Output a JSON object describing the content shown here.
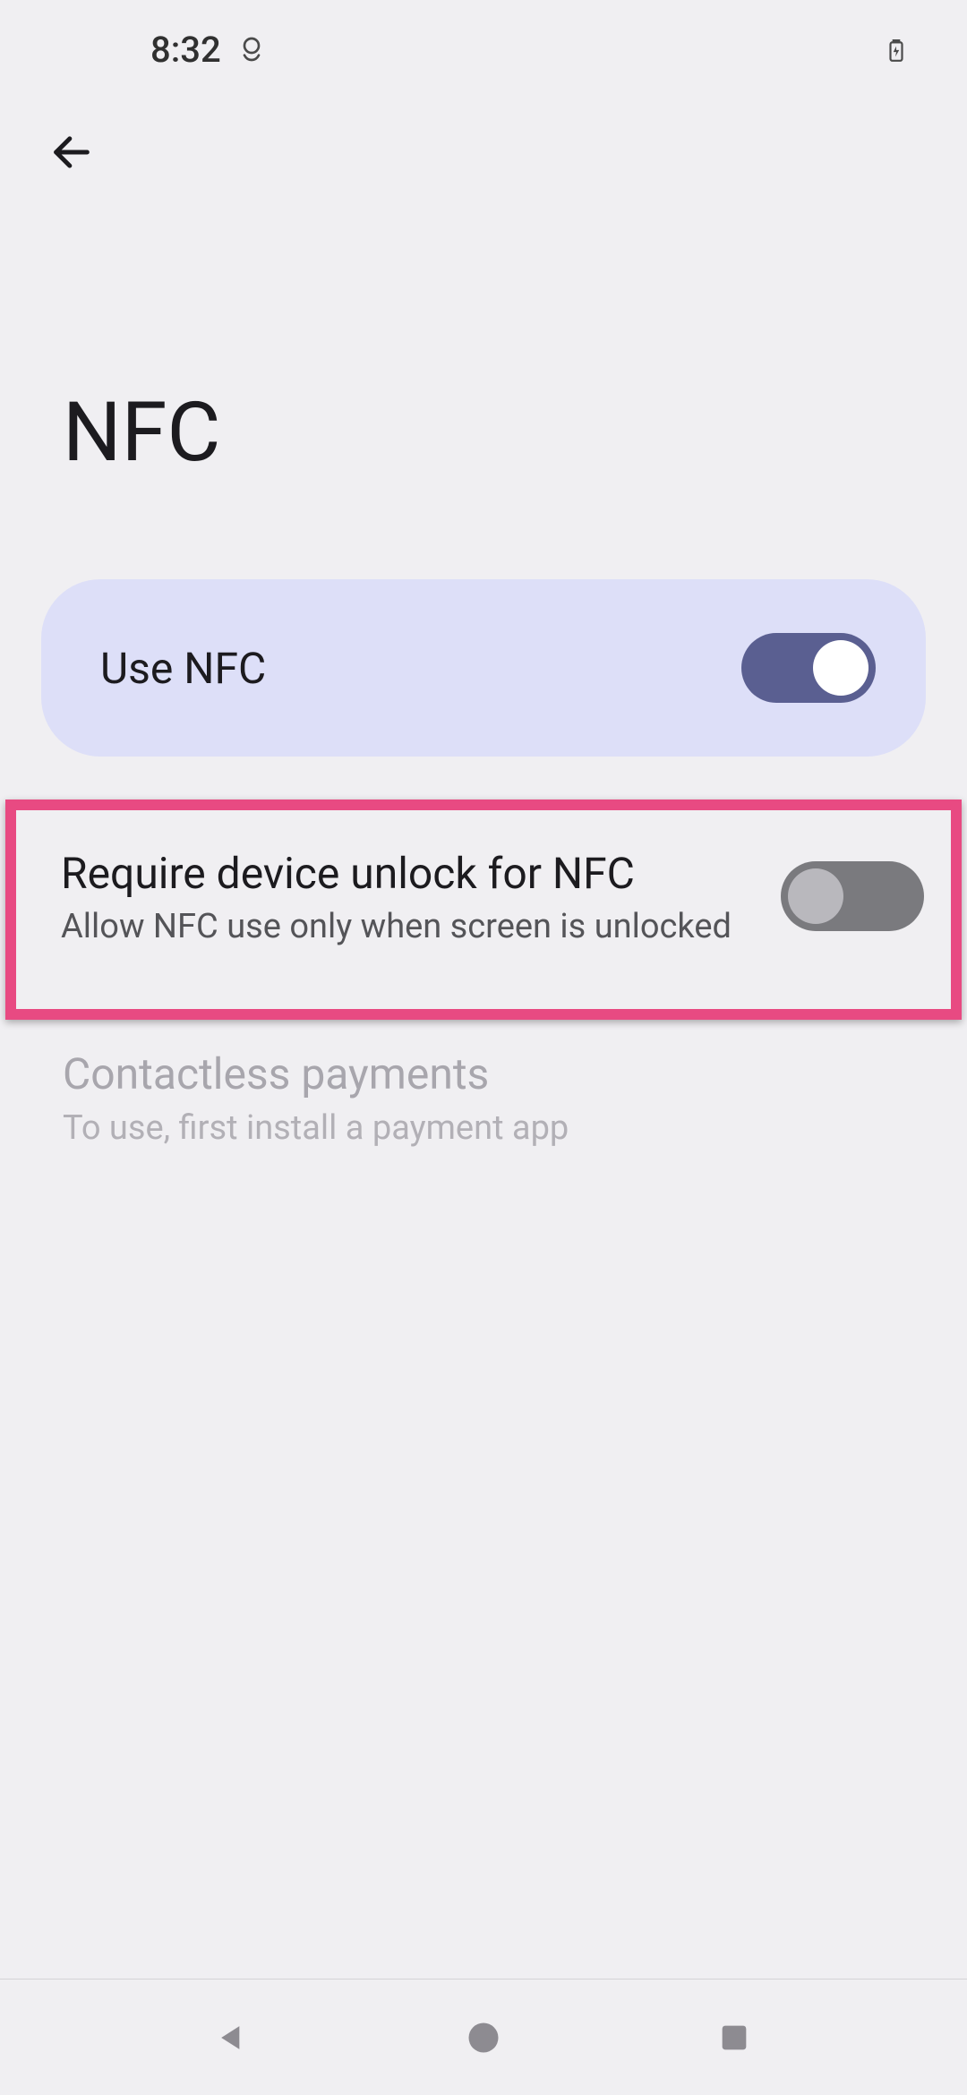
{
  "status": {
    "time": "8:32"
  },
  "header": {
    "title": "NFC"
  },
  "settings": {
    "use_nfc": {
      "label": "Use NFC",
      "on": true
    },
    "require_unlock": {
      "title": "Require device unlock for NFC",
      "subtitle": "Allow NFC use only when screen is unlocked",
      "on": false
    },
    "contactless": {
      "title": "Contactless payments",
      "subtitle": "To use, first install a payment app",
      "enabled": false
    }
  }
}
